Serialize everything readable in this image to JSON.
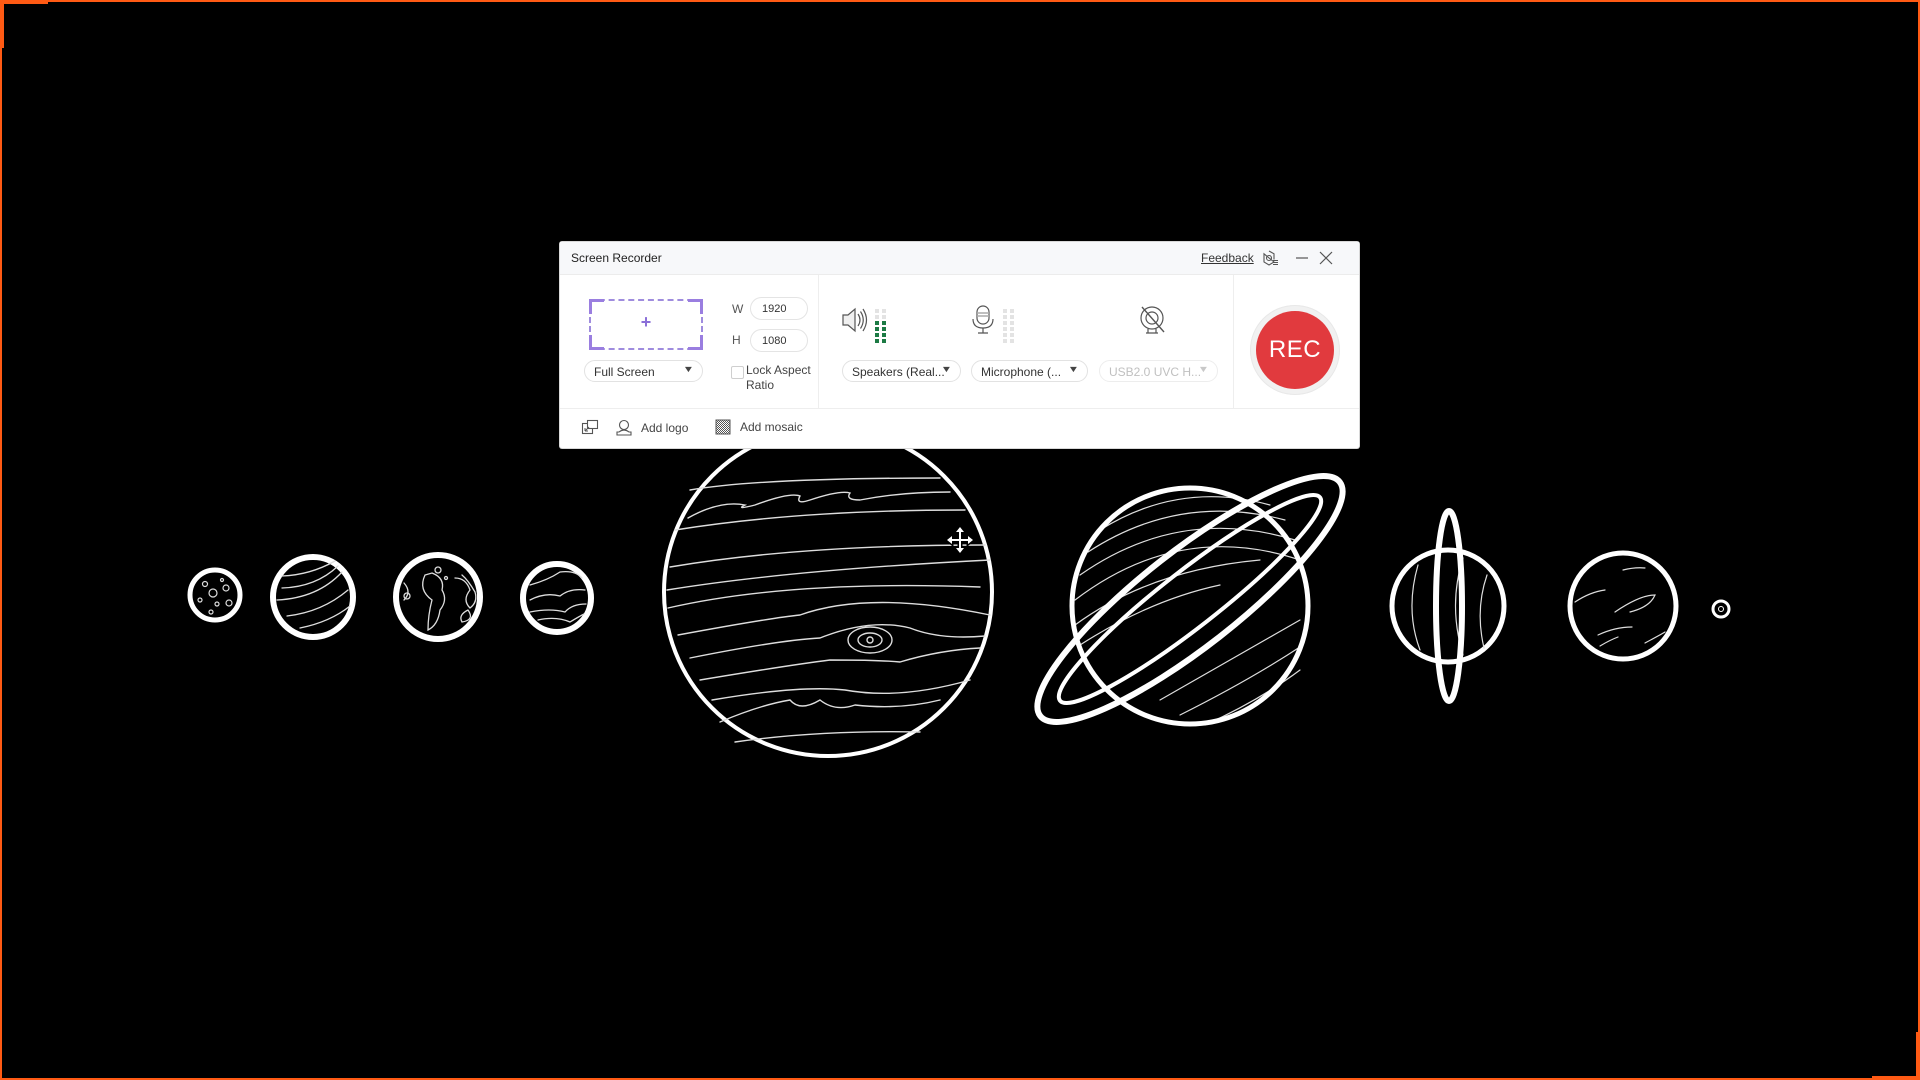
{
  "background": {
    "scene": "solar system line drawing",
    "planets": [
      "mercury",
      "venus",
      "earth",
      "mars",
      "jupiter",
      "saturn",
      "uranus",
      "neptune",
      "pluto"
    ],
    "capture_border_color": "#ff5a14"
  },
  "window": {
    "title": "Screen Recorder",
    "feedback_label": "Feedback",
    "icons": {
      "settings": "settings-gear-icon",
      "minimize": "minimize-icon",
      "close": "close-icon"
    }
  },
  "capture": {
    "region_icon": "plus-icon",
    "width_label": "W",
    "height_label": "H",
    "width_value": "1920",
    "height_value": "1080",
    "mode_selected": "Full Screen",
    "lock_aspect_label": "Lock Aspect Ratio",
    "lock_aspect_checked": false
  },
  "audio": {
    "speaker": {
      "icon": "speaker-icon",
      "selected": "Speakers (Real...",
      "level_bars_on": 4,
      "level_bars_total": 6
    },
    "microphone": {
      "icon": "microphone-icon",
      "selected": "Microphone (...",
      "level_bars_on": 0,
      "level_bars_total": 6
    },
    "webcam": {
      "icon": "webcam-off-icon",
      "selected": "USB2.0 UVC H...",
      "enabled": false
    }
  },
  "record_button": {
    "label": "REC",
    "color": "#e13a3e"
  },
  "toolbar": {
    "pip_icon": "picture-in-picture-icon",
    "add_logo": "Add logo",
    "add_mosaic": "Add mosaic"
  },
  "colors": {
    "accent_purple": "#9a7ee0",
    "meter_green": "#1c7a44"
  }
}
